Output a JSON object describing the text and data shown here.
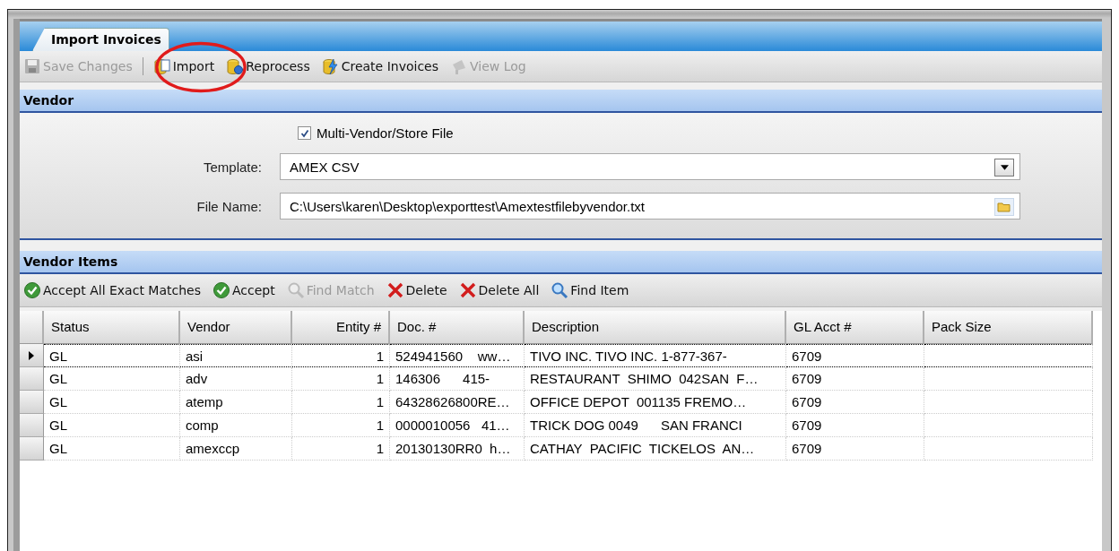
{
  "tab": {
    "label": "Import Invoices",
    "selected": true
  },
  "toolbar": [
    {
      "kind": "save",
      "label": "Save Changes",
      "disabled": true
    },
    {
      "kind": "import",
      "label": "Import",
      "disabled": false
    },
    {
      "kind": "reprocess",
      "label": "Reprocess",
      "disabled": false
    },
    {
      "kind": "create",
      "label": "Create Invoices",
      "disabled": false
    },
    {
      "kind": "log",
      "label": "View Log",
      "disabled": true
    }
  ],
  "vendor": {
    "title": "Vendor",
    "multi_vendor": {
      "label": "Multi-Vendor/Store File",
      "checked": true
    },
    "template": {
      "label": "Template:",
      "value": "AMEX CSV"
    },
    "file_name": {
      "label": "File Name:",
      "value": "C:\\Users\\karen\\Desktop\\exporttest\\Amextestfilebyvendor.txt"
    }
  },
  "vendor_items": {
    "title": "Vendor Items",
    "toolbar": [
      {
        "kind": "accept",
        "label": "Accept All Exact Matches",
        "disabled": false
      },
      {
        "kind": "accept",
        "label": "Accept",
        "disabled": false
      },
      {
        "kind": "find",
        "label": "Find Match",
        "disabled": true
      },
      {
        "kind": "delete",
        "label": "Delete",
        "disabled": false
      },
      {
        "kind": "delete",
        "label": "Delete All",
        "disabled": false
      },
      {
        "kind": "find",
        "label": "Find Item",
        "disabled": false
      }
    ],
    "columns": [
      "Status",
      "Vendor",
      "Entity #",
      "Doc. #",
      "Description",
      "GL Acct #",
      "Pack Size"
    ],
    "rows": [
      {
        "selected": true,
        "cells": [
          "GL",
          "asi",
          "1",
          "524941560    ww…",
          "TIVO INC. TIVO INC. 1-877-367-",
          "6709",
          ""
        ]
      },
      {
        "selected": false,
        "cells": [
          "GL",
          "adv",
          "1",
          "146306      415-",
          "RESTAURANT  SHIMO  042SAN  F…",
          "6709",
          ""
        ]
      },
      {
        "selected": false,
        "cells": [
          "GL",
          "atemp",
          "1",
          "64328626800RE…",
          "OFFICE DEPOT  001135 FREMO…",
          "6709",
          ""
        ]
      },
      {
        "selected": false,
        "cells": [
          "GL",
          "comp",
          "1",
          "0000010056   41…",
          "TRICK DOG 0049      SAN FRANCI",
          "6709",
          ""
        ]
      },
      {
        "selected": false,
        "cells": [
          "GL",
          "amexccp",
          "1",
          "20130130RR0  h…",
          "CATHAY  PACIFIC  TICKELOS  AN…",
          "6709",
          ""
        ]
      }
    ]
  }
}
